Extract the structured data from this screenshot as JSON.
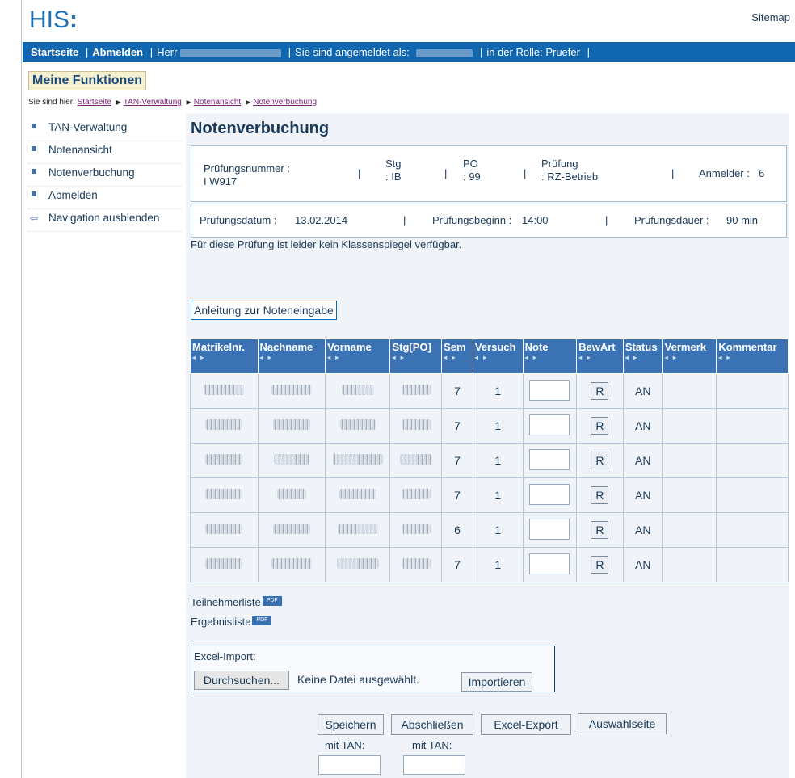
{
  "header": {
    "logo": "HIS",
    "sitemap": "Sitemap"
  },
  "topbar": {
    "startseite": "Startseite",
    "abmelden": "Abmelden",
    "herr": "Herr",
    "angemeldet": "Sie sind angemeldet als:",
    "rolle": "in der Rolle: Pruefer"
  },
  "meine_funktionen": "Meine Funktionen",
  "breadcrumb": {
    "prefix": "Sie sind hier:",
    "items": [
      "Startseite",
      "TAN-Verwaltung",
      "Notenansicht",
      "Notenverbuchung"
    ]
  },
  "sidebar": {
    "items": [
      {
        "label": "TAN-Verwaltung",
        "icon": "bullet-icon"
      },
      {
        "label": "Notenansicht",
        "icon": "bullet-icon"
      },
      {
        "label": "Notenverbuchung",
        "icon": "bullet-icon"
      },
      {
        "label": "Abmelden",
        "icon": "bullet-icon"
      },
      {
        "label": "Navigation ausblenden",
        "icon": "arrow-left-icon"
      }
    ]
  },
  "page_title": "Notenverbuchung",
  "exam": {
    "pruefungsnummer_label": "Prüfungsnummer :",
    "pruefungsnummer": "I W917",
    "stg_label": "Stg",
    "stg": ": IB",
    "po_label": "PO",
    "po": ": 99",
    "pruefung_label": "Prüfung",
    "pruefung": ": RZ-Betrieb",
    "anmelder_label": "Anmelder :",
    "anmelder": "6",
    "datum_label": "Prüfungsdatum :",
    "datum": "13.02.2014",
    "beginn_label": "Prüfungsbeginn :",
    "beginn": "14:00",
    "dauer_label": "Prüfungsdauer :",
    "dauer": "90 min"
  },
  "notice": "Für diese Prüfung ist leider kein Klassenspiegel verfügbar.",
  "anleitung": "Anleitung zur Noteneingabe",
  "table": {
    "columns": [
      "Matrikelnr.",
      "Nachname",
      "Vorname",
      "Stg[PO]",
      "Sem",
      "Versuch",
      "Note",
      "BewArt",
      "Status",
      "Vermerk",
      "Kommentar"
    ],
    "rows": [
      {
        "sem": "7",
        "versuch": "1",
        "bewart": "R",
        "status": "AN"
      },
      {
        "sem": "7",
        "versuch": "1",
        "bewart": "R",
        "status": "AN"
      },
      {
        "sem": "7",
        "versuch": "1",
        "bewart": "R",
        "status": "AN"
      },
      {
        "sem": "7",
        "versuch": "1",
        "bewart": "R",
        "status": "AN"
      },
      {
        "sem": "6",
        "versuch": "1",
        "bewart": "R",
        "status": "AN"
      },
      {
        "sem": "7",
        "versuch": "1",
        "bewart": "R",
        "status": "AN"
      }
    ]
  },
  "lists": {
    "teilnehmer": "Teilnehmerliste",
    "ergebnis": "Ergebnisliste",
    "pdf": "PDF"
  },
  "excel": {
    "label": "Excel-Import:",
    "browse": "Durchsuchen...",
    "nofile": "Keine Datei ausgewählt.",
    "import": "Importieren"
  },
  "actions": {
    "speichern": "Speichern",
    "abschliessen": "Abschließen",
    "export": "Excel-Export",
    "auswahl": "Auswahlseite",
    "mit_tan": "mit TAN:"
  }
}
